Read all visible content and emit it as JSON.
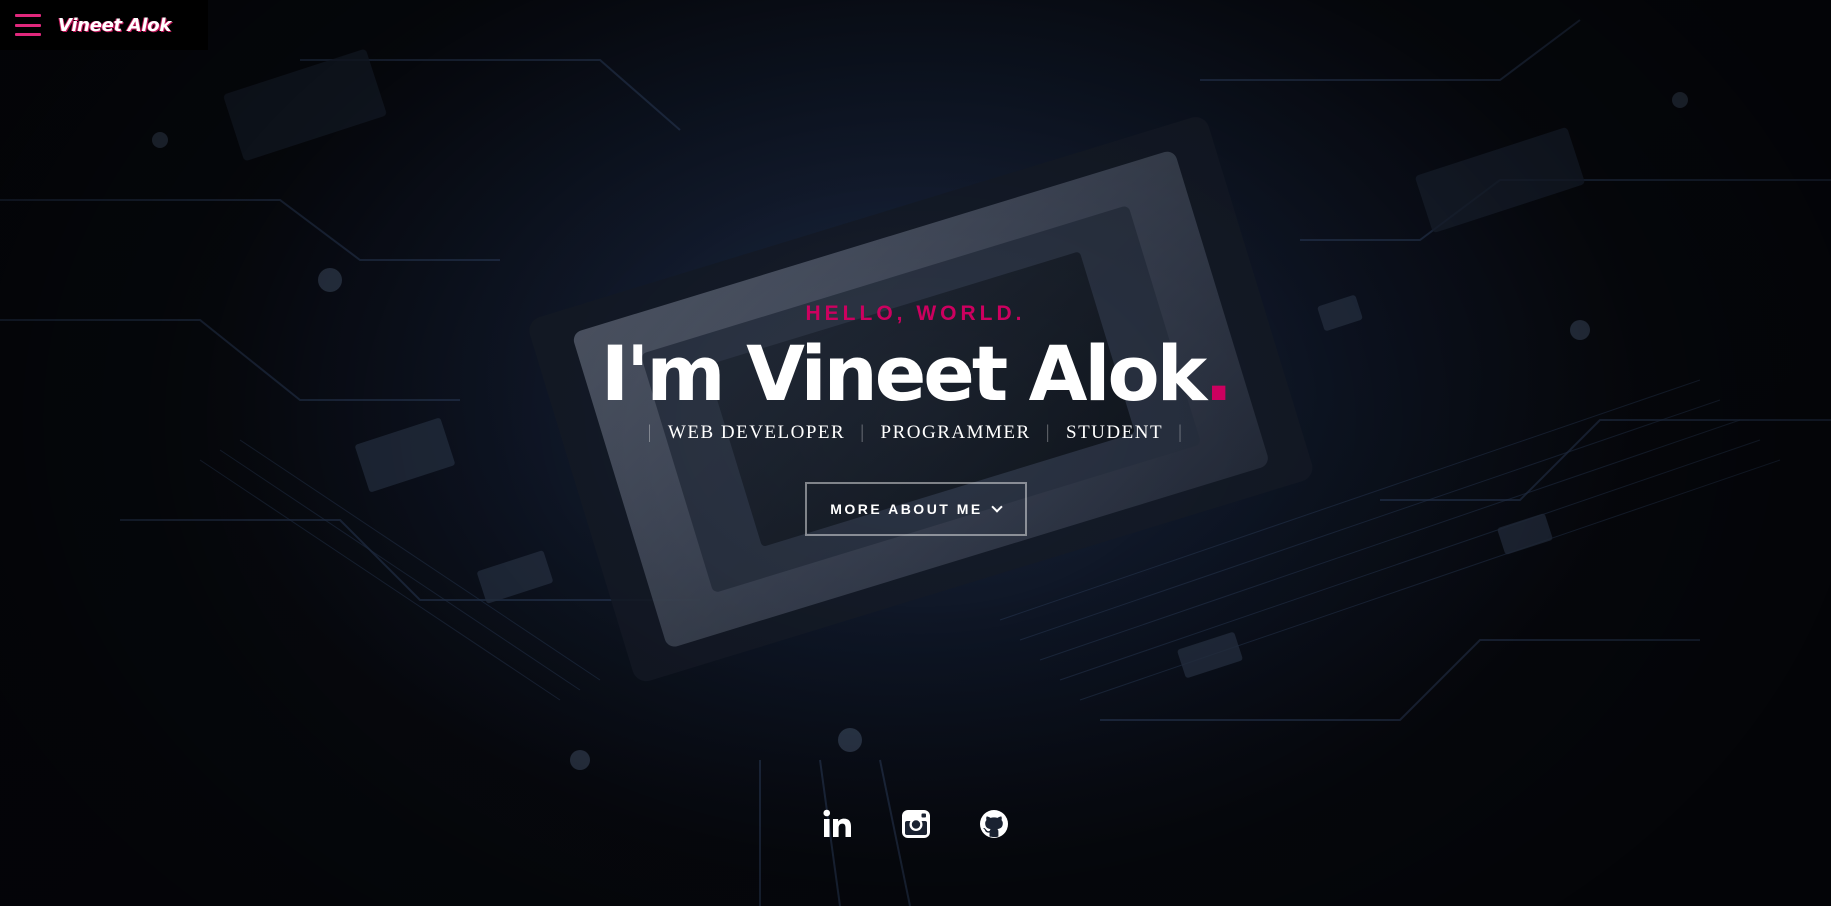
{
  "header": {
    "brand": "Vineet Alok",
    "menu_icon": "hamburger-icon",
    "accent_color": "#e0287c"
  },
  "intro": {
    "greeting": "HELLO, WORLD.",
    "headline": "I'm Vineet Alok",
    "headline_dot": ".",
    "roles": [
      "WEB DEVELOPER",
      "PROGRAMMER",
      "STUDENT"
    ],
    "cta_label": "MORE ABOUT ME",
    "cta_icon": "chevron-down-icon",
    "accent_color": "#cc005f"
  },
  "social": {
    "links": [
      {
        "icon": "linkedin-icon"
      },
      {
        "icon": "instagram-icon"
      },
      {
        "icon": "github-icon"
      }
    ]
  }
}
